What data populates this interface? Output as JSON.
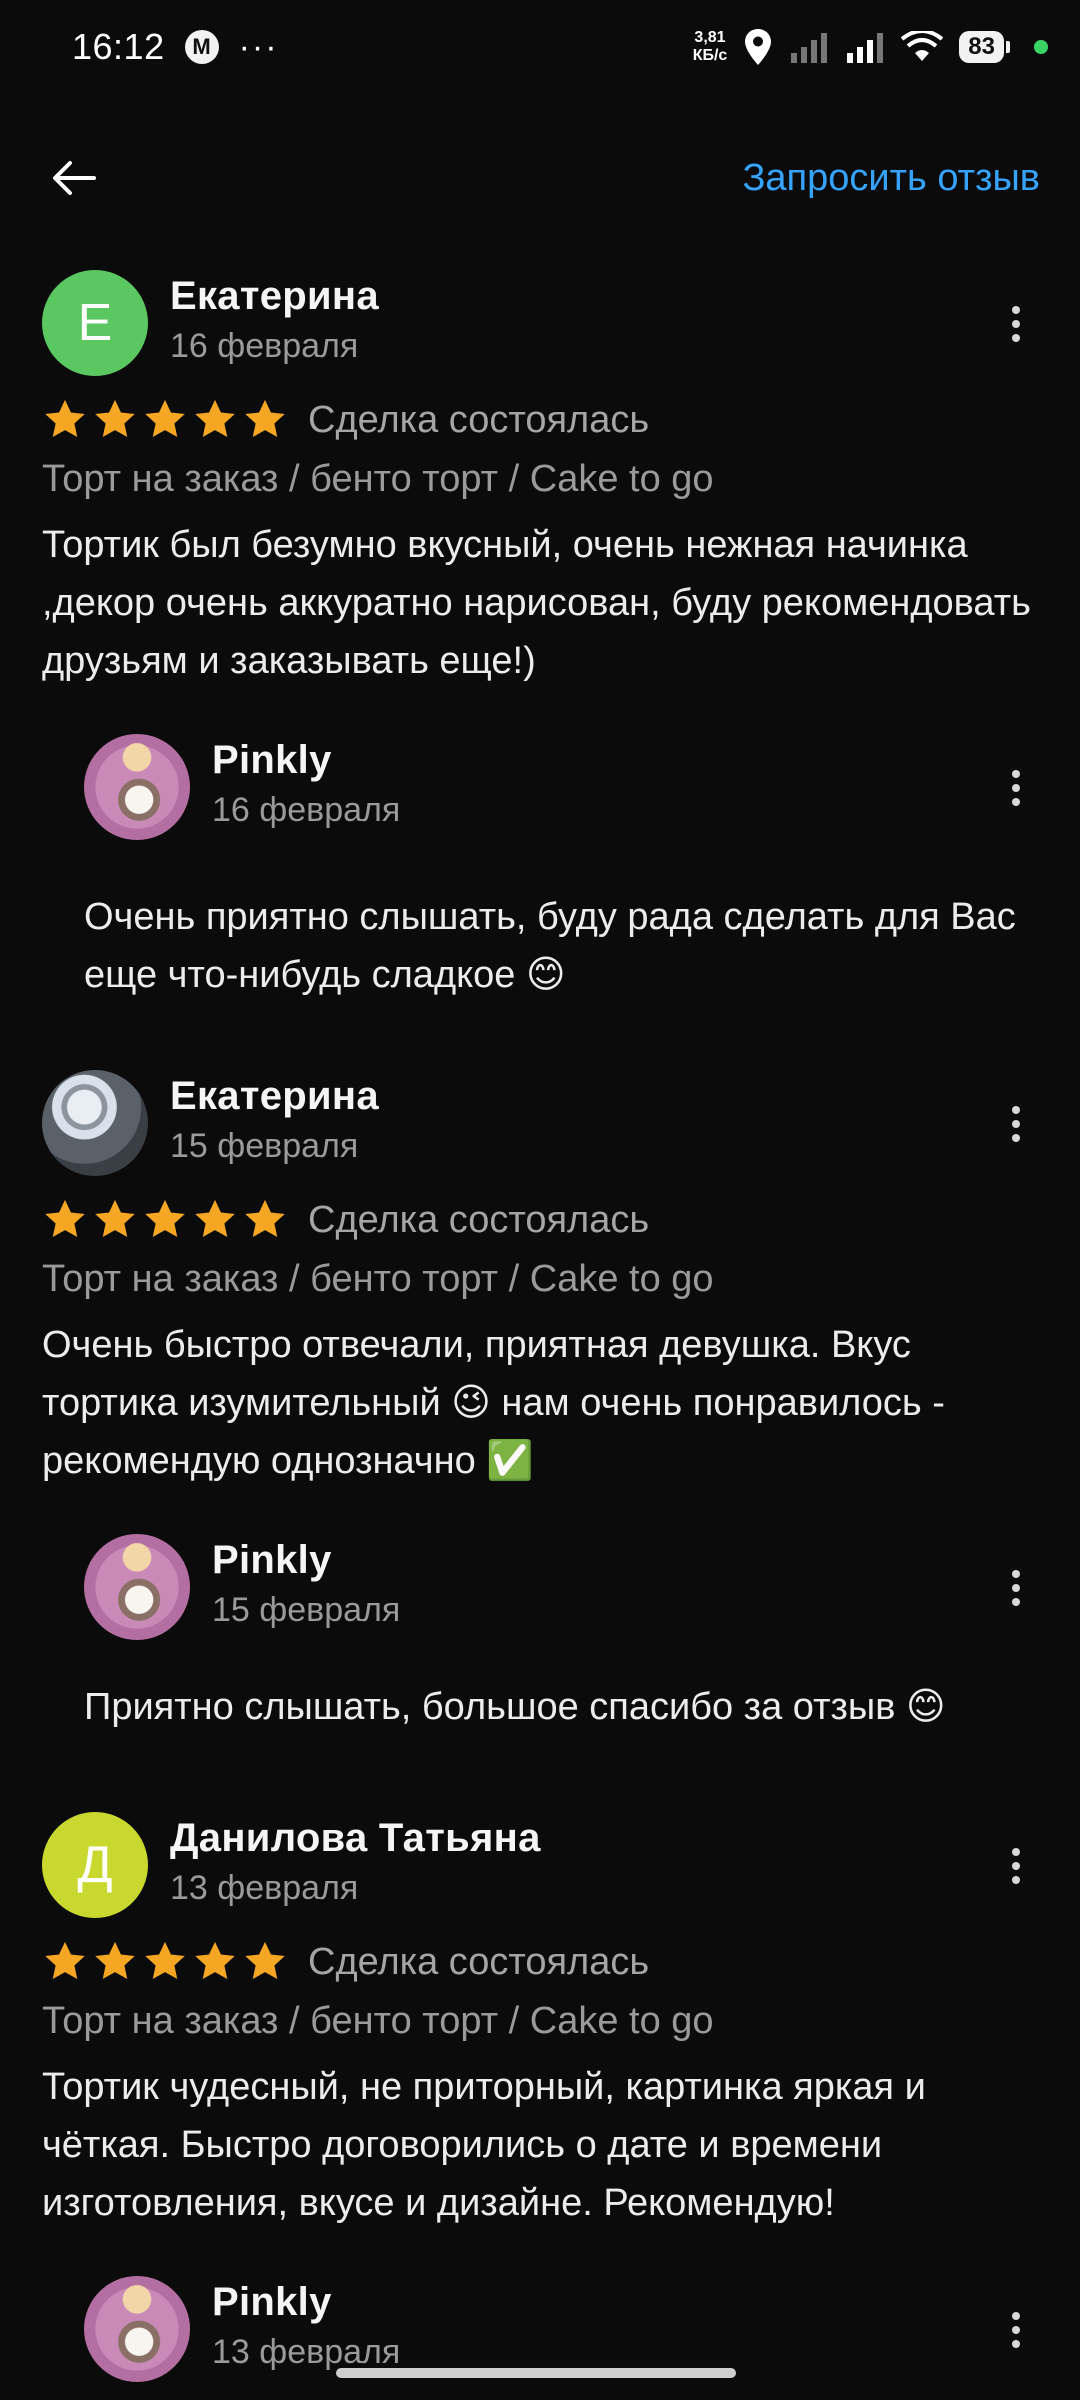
{
  "status_bar": {
    "time": "16:12",
    "mail_icon": "М",
    "more": "···",
    "net_speed_value": "3,81",
    "net_speed_unit": "КБ/с",
    "battery": "83"
  },
  "header": {
    "back_icon": "arrow-left-icon",
    "request_review": "Запросить отзыв"
  },
  "colors": {
    "accent": "#36a3ff",
    "star": "#f5a623",
    "avatar_green": "#5ac760",
    "avatar_lime": "#c9d82f"
  },
  "reviews": [
    {
      "avatar_letter": "Е",
      "author": "Екатерина",
      "date": "16 февраля",
      "rating": 5,
      "status": "Сделка состоялась",
      "listing": "Торт на заказ / бенто торт / Cake to go",
      "text": "Тортик был безумно вкусный, очень нежная начинка ,декор очень аккуратно нарисован, буду рекомендовать друзьям и заказывать еще!)",
      "reply": {
        "author": "Pinkly",
        "date": "16 февраля",
        "text": "Очень приятно слышать, буду рада сделать для Вас еще что-нибудь сладкое 😊"
      }
    },
    {
      "avatar_letter": "",
      "author": "Екатерина",
      "date": "15 февраля",
      "rating": 5,
      "status": "Сделка состоялась",
      "listing": "Торт на заказ / бенто торт / Cake to go",
      "text": "Очень быстро отвечали, приятная девушка. Вкус тортика изумительный 😉 нам очень понравилось - рекомендую однозначно ✅",
      "reply": {
        "author": "Pinkly",
        "date": "15 февраля",
        "text": "Приятно слышать, большое спасибо за отзыв 😊"
      }
    },
    {
      "avatar_letter": "Д",
      "author": "Данилова Татьяна",
      "date": "13 февраля",
      "rating": 5,
      "status": "Сделка состоялась",
      "listing": "Торт на заказ / бенто торт / Cake to go",
      "text": "Тортик чудесный, не приторный, картинка яркая и чёткая. Быстро договорились о дате и времени изготовления, вкусе и дизайне. Рекомендую!",
      "reply": {
        "author": "Pinkly",
        "date": "13 февраля",
        "text": ""
      }
    }
  ]
}
